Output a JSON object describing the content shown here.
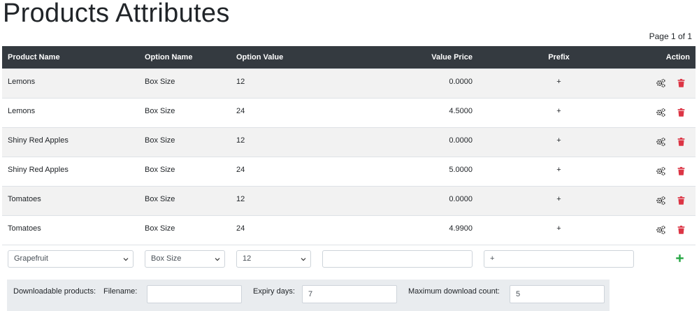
{
  "page": {
    "title": "Products Attributes",
    "page_count": "Page 1 of 1"
  },
  "table": {
    "headers": {
      "product_name": "Product Name",
      "option_name": "Option Name",
      "option_value": "Option Value",
      "value_price": "Value Price",
      "prefix": "Prefix",
      "action": "Action"
    },
    "rows": [
      {
        "product": "Lemons",
        "option_name": "Box Size",
        "option_value": "12",
        "price": "0.0000",
        "prefix": "+"
      },
      {
        "product": "Lemons",
        "option_name": "Box Size",
        "option_value": "24",
        "price": "4.5000",
        "prefix": "+"
      },
      {
        "product": "Shiny Red Apples",
        "option_name": "Box Size",
        "option_value": "12",
        "price": "0.0000",
        "prefix": "+"
      },
      {
        "product": "Shiny Red Apples",
        "option_name": "Box Size",
        "option_value": "24",
        "price": "5.0000",
        "prefix": "+"
      },
      {
        "product": "Tomatoes",
        "option_name": "Box Size",
        "option_value": "12",
        "price": "0.0000",
        "prefix": "+"
      },
      {
        "product": "Tomatoes",
        "option_name": "Box Size",
        "option_value": "24",
        "price": "4.9900",
        "prefix": "+"
      }
    ],
    "row_action_icons": [
      "cogs-icon",
      "trash-icon"
    ]
  },
  "new_row": {
    "product_select": "Grapefruit",
    "option_name_select": "Box Size",
    "option_value_select": "12",
    "price_input": "",
    "prefix_input": "+",
    "add_icon": "plus-icon"
  },
  "downloadable": {
    "label": "Downloadable products:",
    "filename_label": "Filename:",
    "filename_value": "",
    "expiry_label": "Expiry days:",
    "expiry_value": "7",
    "max_label": "Maximum download count:",
    "max_value": "5"
  },
  "colors": {
    "header_bg": "#343a40",
    "stripe": "#f2f2f2",
    "delete": "#dc3545",
    "add": "#28a745",
    "panel": "#e9ecef"
  }
}
